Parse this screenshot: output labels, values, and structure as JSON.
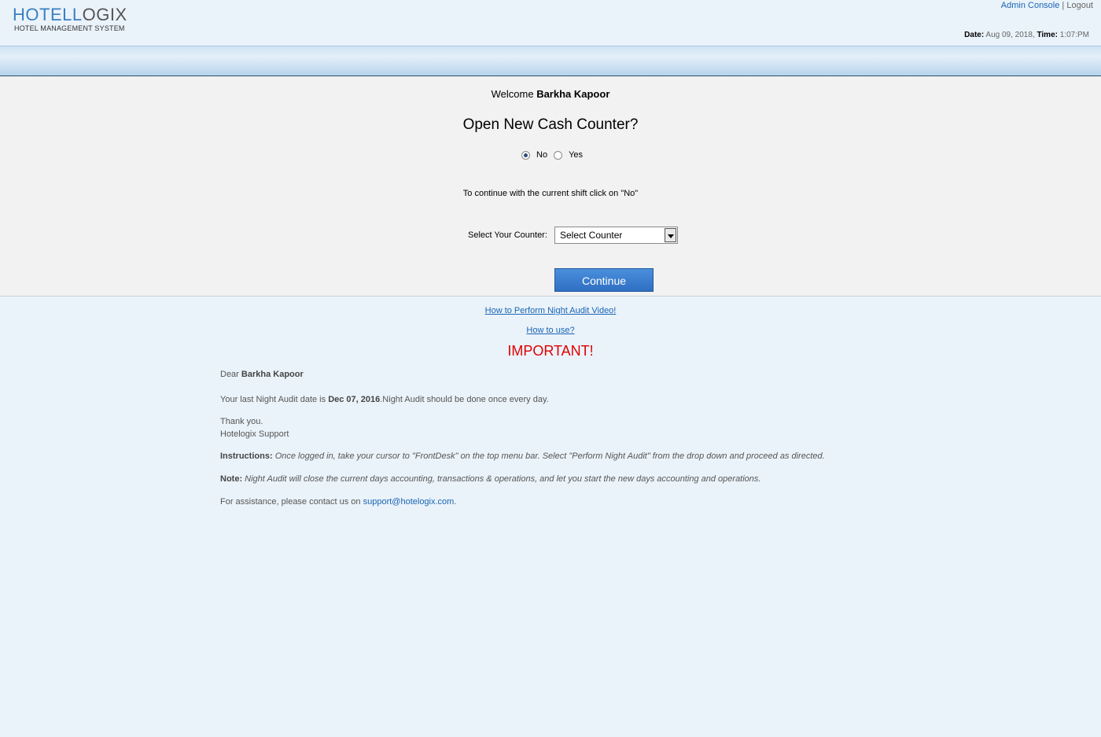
{
  "header": {
    "logo_part1": "HOTEL",
    "logo_part2": "OGIX",
    "logo_L": "L",
    "logo_subtitle": "HOTEL MANAGEMENT SYSTEM",
    "admin_console": "Admin Console",
    "separator": "|",
    "logout": "Logout",
    "date_label": "Date:",
    "date_value": "Aug 09, 2018,",
    "time_label": "Time:",
    "time_value": "1:07:PM"
  },
  "panel": {
    "welcome_prefix": "Welcome",
    "user_name": "Barkha Kapoor",
    "question": "Open New Cash Counter?",
    "radio_no": "No",
    "radio_yes": "Yes",
    "selected_option": "No",
    "continue_note": "To continue with the current shift click on \"No\"",
    "counter_label": "Select Your Counter:",
    "counter_select_value": "Select Counter",
    "continue_button": "Continue"
  },
  "links": {
    "night_audit_video": "How to Perform Night Audit Video!",
    "how_to_use": "How to use?"
  },
  "notice": {
    "important": "IMPORTANT!",
    "dear": "Dear",
    "user_name": "Barkha Kapoor",
    "last_audit_prefix": "Your last Night Audit date is",
    "last_audit_date": "Dec 07, 2016",
    "last_audit_suffix": ".Night Audit should be done once every day.",
    "thank_you": "Thank you.",
    "signature": "Hotelogix Support",
    "instructions_label": "Instructions:",
    "instructions_text": "Once logged in, take your cursor to \"FrontDesk\" on the top menu bar. Select \"Perform Night Audit\" from the drop down and proceed as directed.",
    "note_label": "Note:",
    "note_text": "Night Audit will close the current days accounting, transactions & operations, and let you start the new days accounting and operations.",
    "assistance_prefix": "For assistance, please contact us on",
    "support_email": "support@hotelogix.com",
    "assistance_suffix": "."
  },
  "colors": {
    "page_background": "#eaf3fa",
    "link_blue": "#1a64b4",
    "important_red": "#e00000",
    "button_blue": "#3a7fd0"
  }
}
